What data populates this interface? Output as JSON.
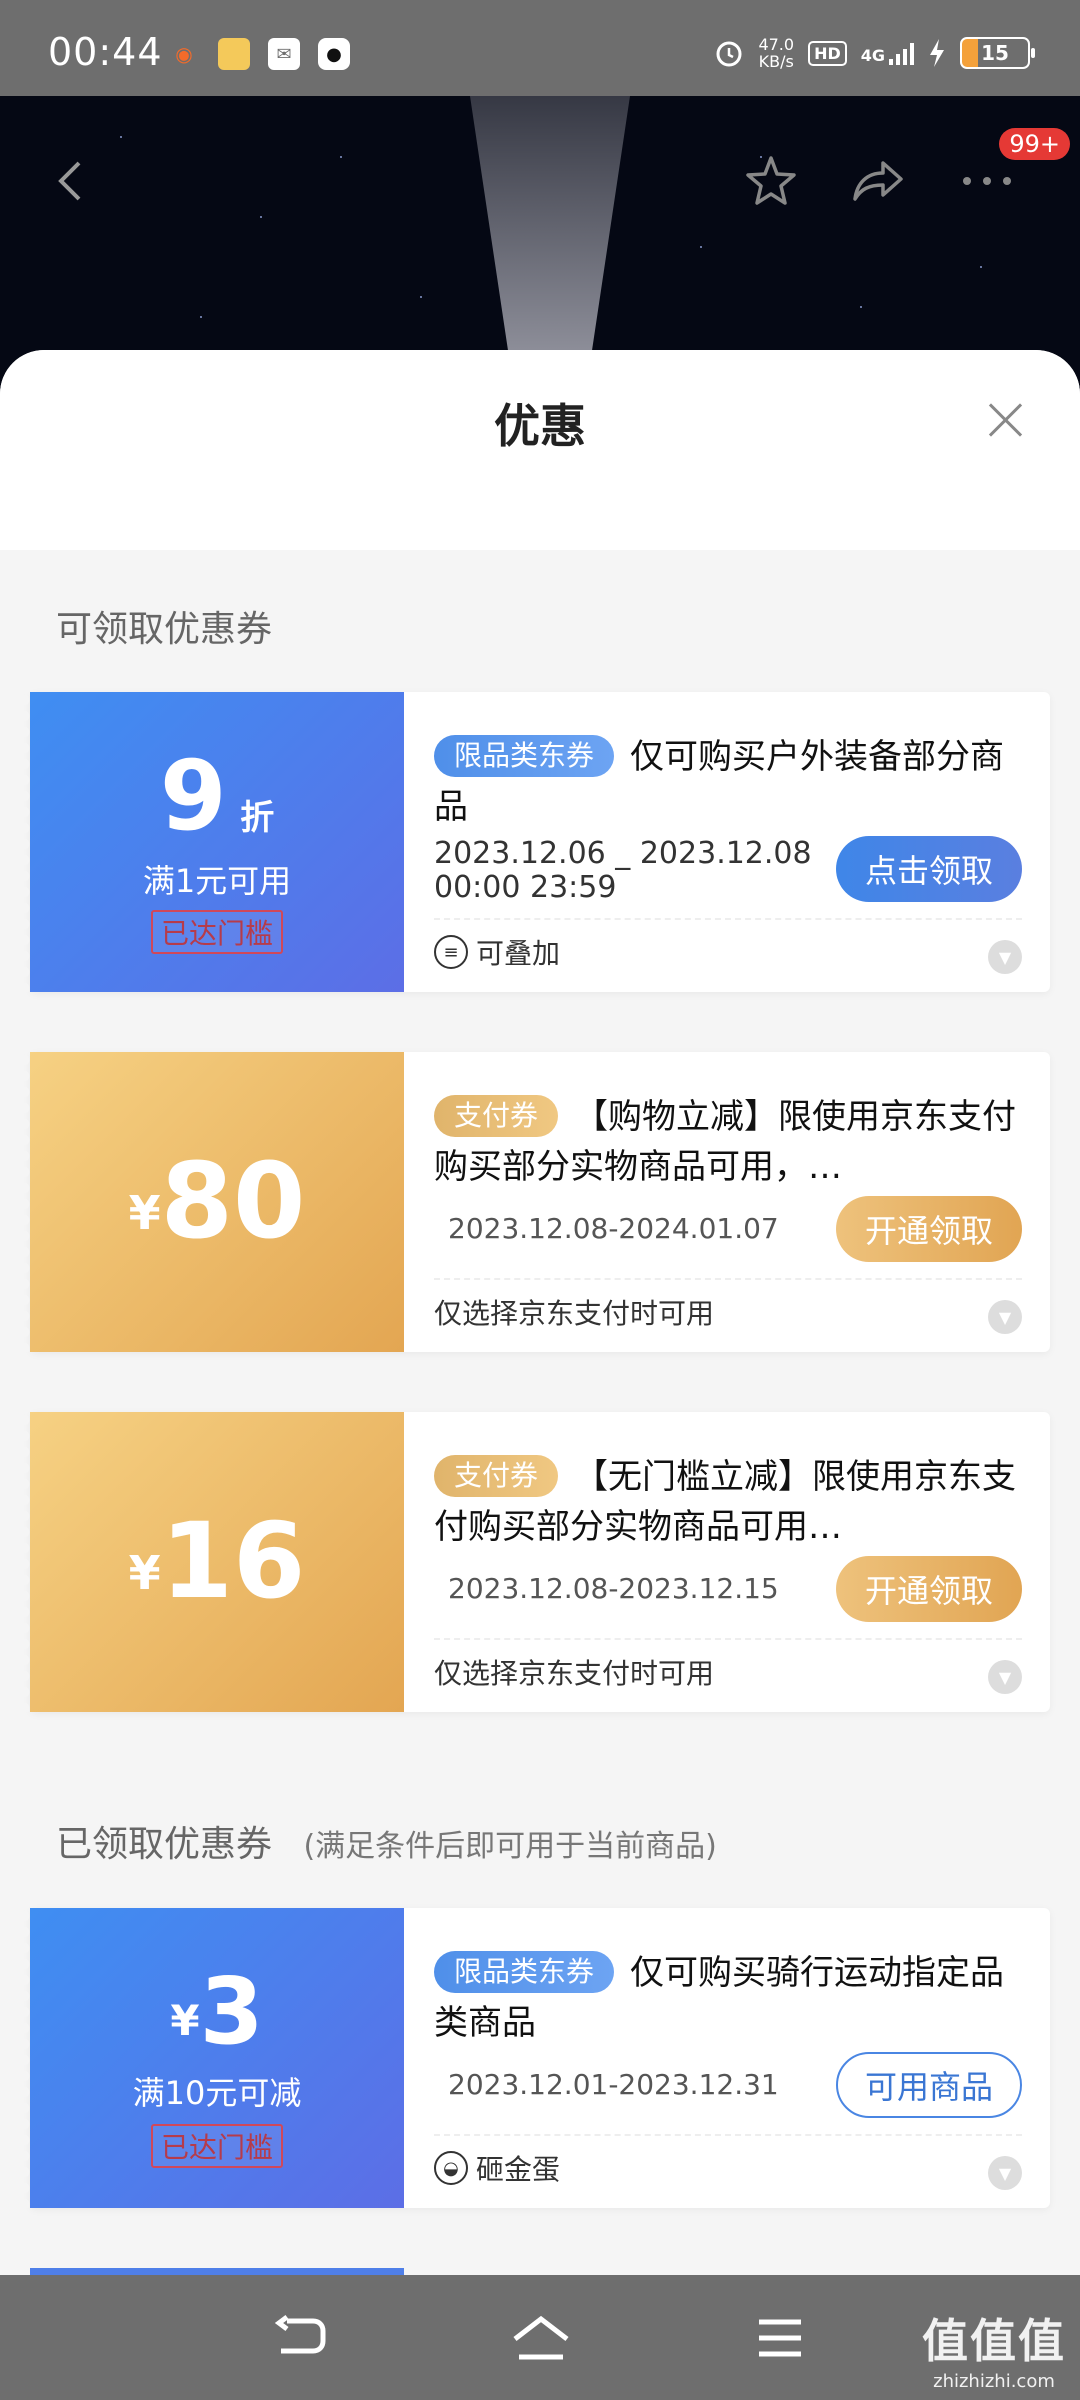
{
  "status_bar": {
    "time": "00:44",
    "net_speed": "47.0",
    "net_unit": "KB/s",
    "hd": "HD",
    "network": "4G",
    "battery": "15",
    "app_icons": [
      "weibo-app-icon",
      "game-app-icon",
      "mail-app-icon",
      "qq-app-icon"
    ]
  },
  "header": {
    "back_icon": "back-arrow-icon",
    "favorite_icon": "star-icon",
    "share_icon": "share-icon",
    "more_icon": "more-icon",
    "badge": "99+"
  },
  "sheet": {
    "title": "优惠",
    "close_icon": "close-icon"
  },
  "available_section": {
    "title": "可领取优惠券",
    "coupons": [
      {
        "amount": "9",
        "amount_unit": "折",
        "condition": "满1元可用",
        "reached": "已达门槛",
        "tag": "限品类东券",
        "desc": "仅可购买户外装备部分商品",
        "date": "2023.12.06 _ 2023.12.08\n00:00 23:59",
        "button": "点击领取",
        "footer": "可叠加",
        "color": "#4f7fe8"
      },
      {
        "amount_prefix": "¥",
        "amount": "80",
        "tag": "支付券",
        "desc": "【购物立减】限使用京东支付购买部分实物商品可用，…",
        "date": "2023.12.08-2024.01.07",
        "button": "开通领取",
        "footer": "仅选择京东支付时可用",
        "color": "#e9b462"
      },
      {
        "amount_prefix": "¥",
        "amount": "16",
        "tag": "支付券",
        "desc": "【无门槛立减】限使用京东支付购买部分实物商品可用…",
        "date": "2023.12.08-2023.12.15",
        "button": "开通领取",
        "footer": "仅选择京东支付时可用",
        "color": "#e9b462"
      }
    ]
  },
  "claimed_section": {
    "title": "已领取优惠券",
    "subtitle": "(满足条件后即可用于当前商品)",
    "coupons": [
      {
        "amount_prefix": "¥",
        "amount": "3",
        "condition": "满10元可减",
        "reached": "已达门槛",
        "tag": "限品类东券",
        "desc": "仅可购买骑行运动指定品类商品",
        "date": "2023.12.01-2023.12.31",
        "button": "可用商品",
        "footer": "砸金蛋",
        "color": "#4f7fe8"
      }
    ]
  },
  "nav": {
    "back_icon": "nav-back-icon",
    "home_icon": "nav-home-icon",
    "menu_icon": "nav-menu-icon",
    "watermark": "值值值",
    "watermark_url": "zhizhizhi.com"
  }
}
